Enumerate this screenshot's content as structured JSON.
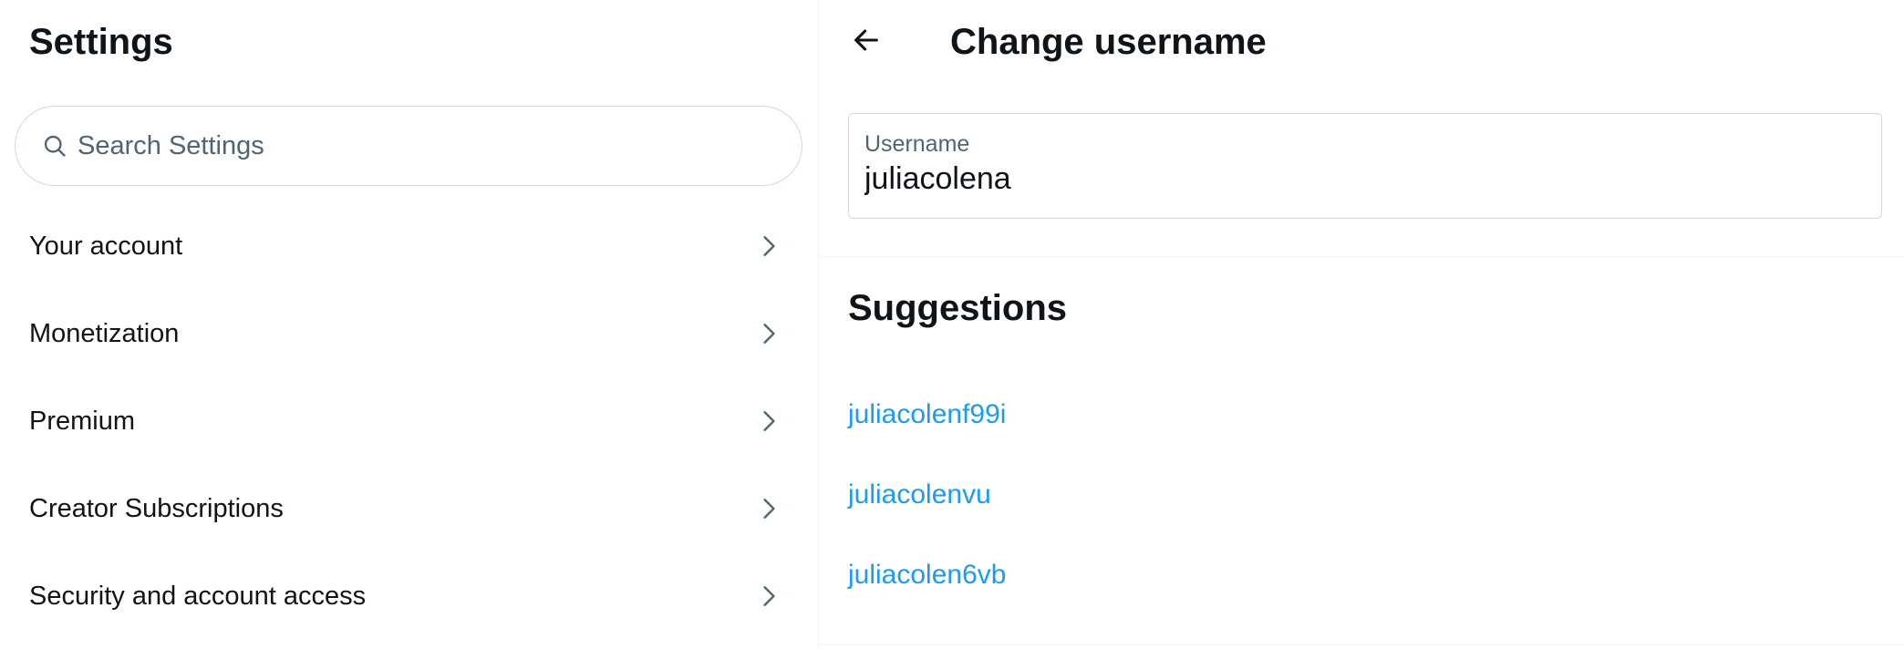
{
  "settings": {
    "title": "Settings",
    "search": {
      "placeholder": "Search Settings",
      "value": ""
    },
    "items": [
      {
        "label": "Your account"
      },
      {
        "label": "Monetization"
      },
      {
        "label": "Premium"
      },
      {
        "label": "Creator Subscriptions"
      },
      {
        "label": "Security and account access"
      }
    ]
  },
  "change_username": {
    "title": "Change username",
    "field_label": "Username",
    "value": "juliacolena",
    "suggestions_title": "Suggestions",
    "suggestions": [
      "juliacolenf99i",
      "juliacolenvu",
      "juliacolen6vb"
    ]
  },
  "colors": {
    "text": "#0f1419",
    "muted": "#536471",
    "link": "#1d9bf0",
    "border": "#cfd9de",
    "divider": "#eff3f4"
  },
  "icons": {
    "search": "search-icon",
    "chevron": "chevron-right-icon",
    "back": "arrow-left-icon"
  }
}
